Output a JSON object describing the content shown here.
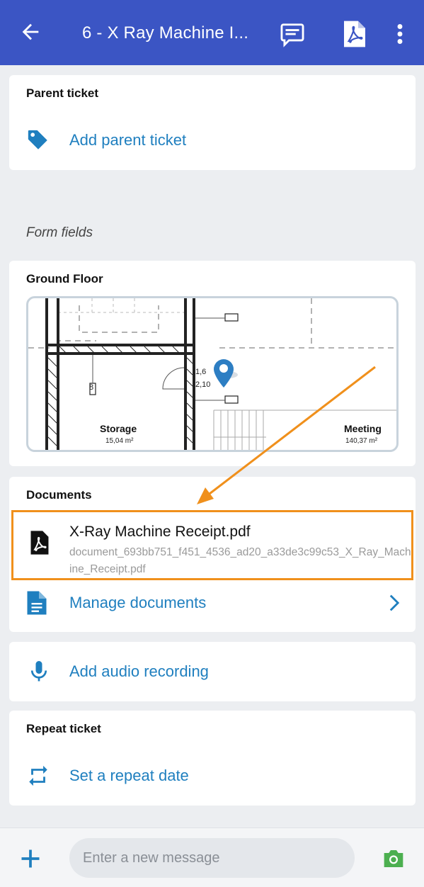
{
  "header": {
    "title": "6 - X Ray Machine I...",
    "back_icon": "arrow-left-icon",
    "chat_icon": "chat-icon",
    "pdf_icon": "pdf-icon",
    "more_icon": "more-vertical-icon",
    "bg_color": "#3b55c4"
  },
  "parent_ticket": {
    "title": "Parent ticket",
    "action_label": "Add parent ticket",
    "icon": "tag-icon"
  },
  "form_fields": {
    "section_label": "Form fields",
    "floor_plan": {
      "title": "Ground Floor",
      "room_left_name": "Storage",
      "room_left_area": "15,04 m²",
      "room_right_name": "Meeting",
      "room_right_area": "140,37 m²",
      "marker_text_1": "1,6",
      "marker_text_2": "2,10",
      "room_number": "8"
    }
  },
  "documents": {
    "title": "Documents",
    "items": [
      {
        "name": "X-Ray Machine Receipt.pdf",
        "path": "document_693bb751_f451_4536_ad20_a33de3c99c53_X_Ray_Machine_Receipt.pdf",
        "icon": "pdf-file-icon"
      }
    ],
    "manage_label": "Manage documents",
    "manage_icon": "document-icon",
    "chevron_icon": "chevron-right-icon"
  },
  "audio": {
    "label": "Add audio recording",
    "icon": "microphone-icon"
  },
  "repeat_ticket": {
    "title": "Repeat ticket",
    "action_label": "Set a repeat date",
    "icon": "repeat-icon"
  },
  "composer": {
    "placeholder": "Enter a new message",
    "add_icon": "plus-icon",
    "camera_icon": "camera-icon"
  },
  "colors": {
    "link": "#1f7fbf",
    "highlight": "#f0901c",
    "camera": "#4caf50"
  }
}
